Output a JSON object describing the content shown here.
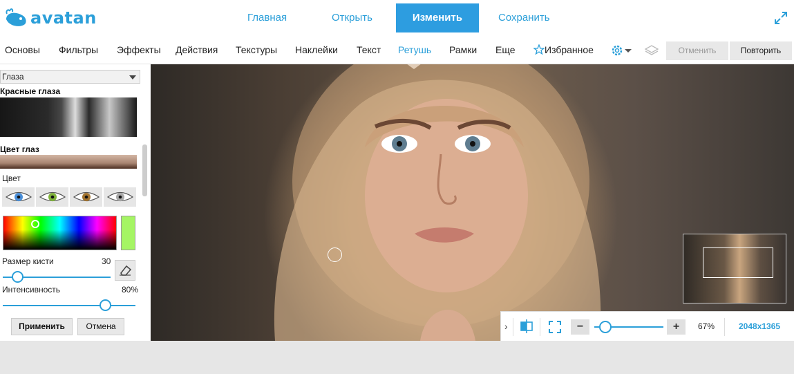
{
  "app": {
    "logo_text": "avatan"
  },
  "topnav": {
    "home": "Главная",
    "open": "Открыть",
    "edit": "Изменить",
    "save": "Сохранить"
  },
  "menu": {
    "items": [
      "Основы",
      "Фильтры",
      "Эффекты",
      "Действия",
      "Текстуры",
      "Наклейки",
      "Текст",
      "Ретушь",
      "Рамки",
      "Еще"
    ],
    "selected": "Ретушь",
    "favorites": "Избранное",
    "undo": "Отменить",
    "redo": "Повторить"
  },
  "sidebar": {
    "category": "Глаза",
    "red_eye_title": "Красные глаза",
    "eye_color_title": "Цвет глаз",
    "color_label": "Цвет",
    "eye_presets": [
      {
        "name": "blue",
        "color": "#4a8fd9"
      },
      {
        "name": "green",
        "color": "#7fb23a"
      },
      {
        "name": "brown",
        "color": "#a2732f"
      },
      {
        "name": "gray",
        "color": "#a9a9a9"
      }
    ],
    "selected_color": "#a5f564",
    "brush_size_label": "Размер кисти",
    "brush_size_value": "30",
    "intensity_label": "Интенсивность",
    "intensity_value": "80%",
    "apply": "Применить",
    "cancel": "Отмена"
  },
  "zoom": {
    "percent": "67%",
    "image_size": "2048x1365"
  }
}
